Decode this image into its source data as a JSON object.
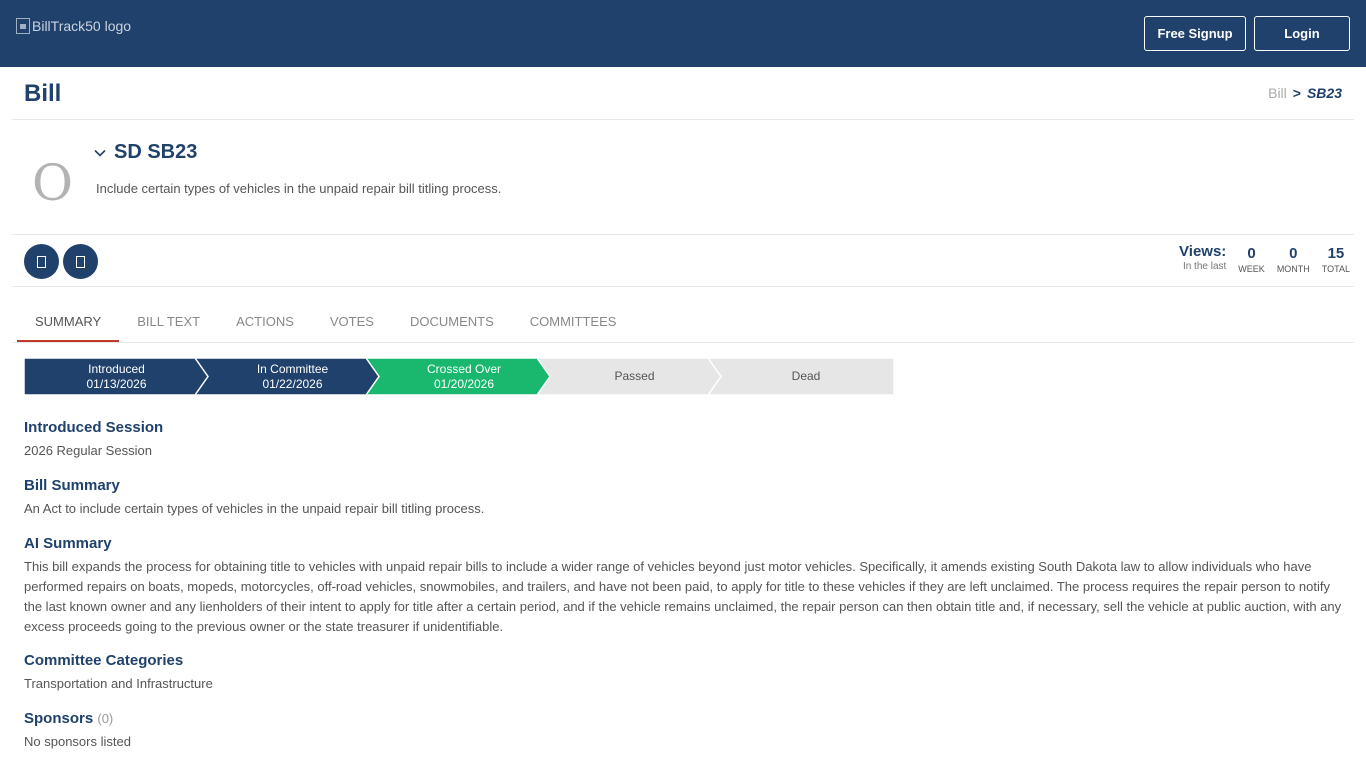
{
  "header": {
    "logo_alt": "BillTrack50 logo",
    "signup_label": "Free Signup",
    "login_label": "Login"
  },
  "page": {
    "title": "Bill",
    "breadcrumb": {
      "root": "Bill",
      "separator": ">",
      "current": "SB23"
    }
  },
  "bill": {
    "avatar_letter": "O",
    "name": "SD SB23",
    "description": "Include certain types of vehicles in the unpaid repair bill titling process."
  },
  "actions": {
    "icons": [
      "bookmark-icon",
      "share-icon"
    ]
  },
  "views": {
    "label": "Views:",
    "sublabel": "In the last",
    "stats": [
      {
        "value": "0",
        "label": "WEEK"
      },
      {
        "value": "0",
        "label": "MONTH"
      },
      {
        "value": "15",
        "label": "TOTAL"
      }
    ]
  },
  "tabs": [
    {
      "label": "SUMMARY",
      "active": true
    },
    {
      "label": "BILL TEXT"
    },
    {
      "label": "ACTIONS"
    },
    {
      "label": "VOTES"
    },
    {
      "label": "DOCUMENTS"
    },
    {
      "label": "COMMITTEES"
    }
  ],
  "progress": [
    {
      "label": "Introduced",
      "date": "01/13/2026",
      "state": "done"
    },
    {
      "label": "In Committee",
      "date": "01/22/2026",
      "state": "done"
    },
    {
      "label": "Crossed Over",
      "date": "01/20/2026",
      "state": "current"
    },
    {
      "label": "Passed",
      "date": "",
      "state": "pending"
    },
    {
      "label": "Dead",
      "date": "",
      "state": "pending"
    }
  ],
  "colors": {
    "navy": "#1f416b",
    "green": "#19b86e",
    "pending": "#e6e6e6",
    "tab_underline": "#c0392b"
  },
  "sections": {
    "session": {
      "heading": "Introduced Session",
      "text": "2026 Regular Session"
    },
    "bill_summary": {
      "heading": "Bill Summary",
      "text": "An Act to include certain types of vehicles in the unpaid repair bill titling process."
    },
    "ai_summary": {
      "heading": "AI Summary",
      "text": "This bill expands the process for obtaining title to vehicles with unpaid repair bills to include a wider range of vehicles beyond just motor vehicles. Specifically, it amends existing South Dakota law to allow individuals who have performed repairs on boats, mopeds, motorcycles, off-road vehicles, snowmobiles, and trailers, and have not been paid, to apply for title to these vehicles if they are left unclaimed. The process requires the repair person to notify the last known owner and any lienholders of their intent to apply for title after a certain period, and if the vehicle remains unclaimed, the repair person can then obtain title and, if necessary, sell the vehicle at public auction, with any excess proceeds going to the previous owner or the state treasurer if unidentifiable."
    },
    "committee": {
      "heading": "Committee Categories",
      "text": "Transportation and Infrastructure"
    },
    "sponsors": {
      "heading": "Sponsors",
      "count": "(0)",
      "text": "No sponsors listed"
    }
  }
}
